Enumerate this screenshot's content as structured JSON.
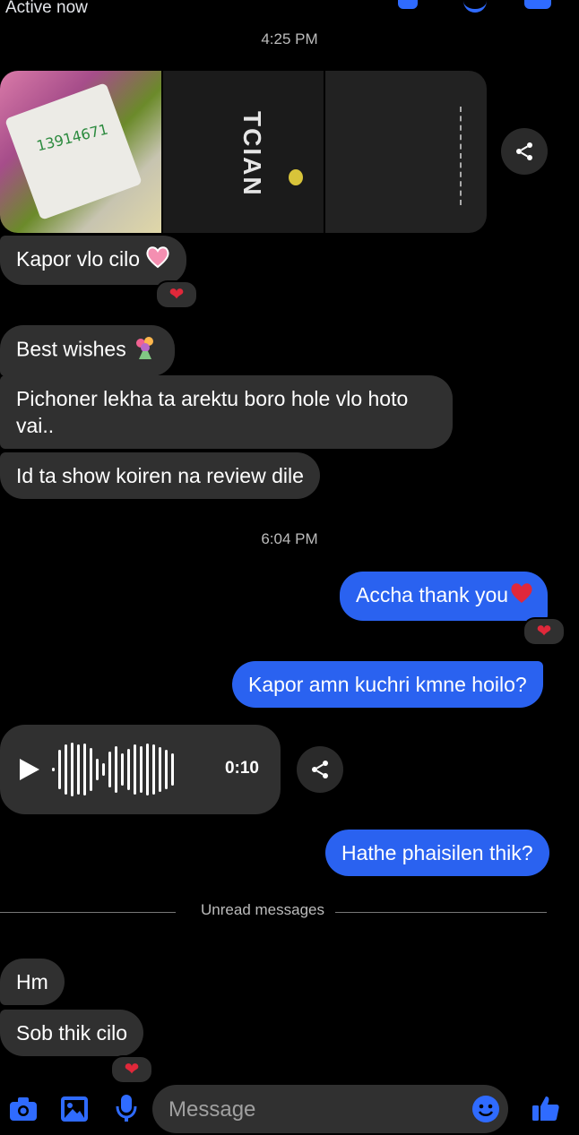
{
  "header": {
    "status": "Active now"
  },
  "timestamps": [
    "4:25 PM",
    "6:04 PM"
  ],
  "photos": {
    "package_label": "13914671",
    "shirt_brand": "TCIAN"
  },
  "messages": {
    "m1": "Kapor vlo cilo",
    "m2": "Best wishes",
    "m3a": "Pichoner lekha ta arektu boro hole vlo hoto",
    "m3b": "vai..",
    "m4": "Id ta show koiren na review dile",
    "m5": "Accha thank you",
    "m6": "Kapor amn kuchri kmne hoilo?",
    "m7": "Hathe phaisilen thik?",
    "m8": "Hm",
    "m9": "Sob thik cilo"
  },
  "voice_message": {
    "duration": "0:10"
  },
  "divider": {
    "label": "Unread messages"
  },
  "composer": {
    "placeholder": "Message"
  },
  "colors": {
    "outgoing": "#2a62f0",
    "incoming": "#303030",
    "accent": "#2f6bff"
  },
  "icons": [
    "camera-icon",
    "image-icon",
    "microphone-icon",
    "emoji-icon",
    "thumbs-up-icon",
    "share-icon",
    "play-icon",
    "heart-icon"
  ]
}
